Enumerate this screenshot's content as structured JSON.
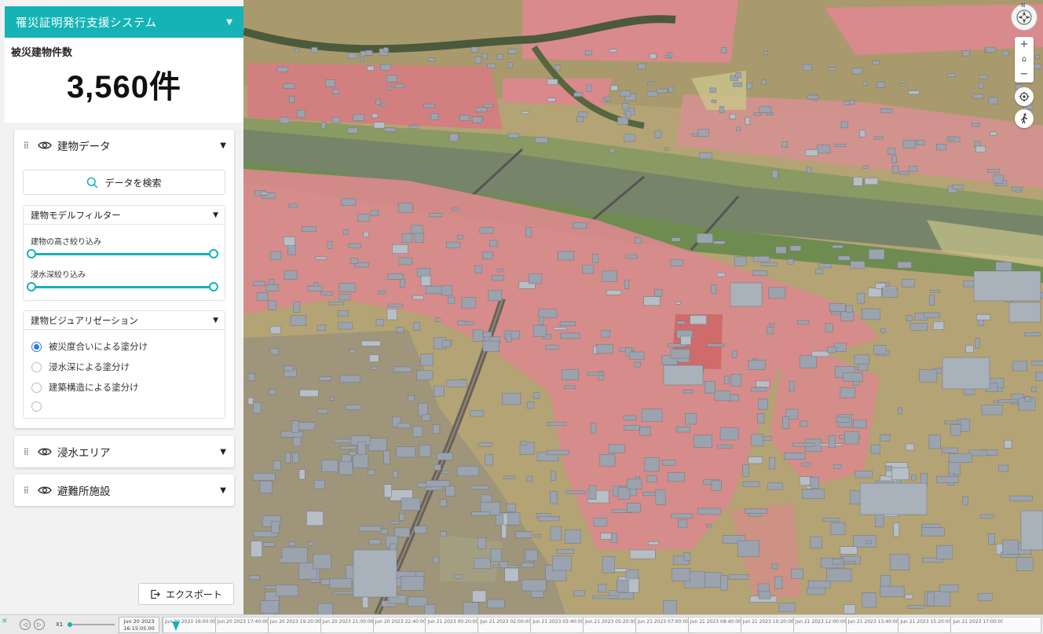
{
  "app": {
    "title": "罹災証明発行支援システム"
  },
  "summary": {
    "label": "被災建物件数",
    "value": "3,560件"
  },
  "layers": {
    "buildings": {
      "name": "建物データ",
      "search_label": "データを検索",
      "filter": {
        "title": "建物モデルフィルター",
        "height_label": "建物の高さ絞り込み",
        "depth_label": "浸水深絞り込み"
      },
      "visualization": {
        "title": "建物ビジュアリゼーション",
        "options": [
          {
            "label": "被災度合いによる塗分け",
            "selected": true
          },
          {
            "label": "浸水深による塗分け",
            "selected": false
          },
          {
            "label": "建築構造による塗分け",
            "selected": false
          },
          {
            "label": "",
            "selected": false
          }
        ]
      }
    },
    "flood_area": {
      "name": "浸水エリア"
    },
    "shelters": {
      "name": "避難所施設"
    }
  },
  "export": {
    "label": "エクスポート"
  },
  "controls": {
    "compass_north": "N",
    "zoom_in": "+",
    "home": "⌂",
    "zoom_out": "−"
  },
  "timeline": {
    "speed": "X1",
    "current_date": "Jun 20 2023",
    "current_time": "16:15:05.00",
    "ticks": [
      "Jun 20 2023 16:00:00.00",
      "Jun 20 2023 17:40:00.00",
      "Jun 20 2023 19:20:00.00",
      "Jun 20 2023 21:00:00.00",
      "Jun 20 2023 22:40:00.00",
      "Jun 21 2023 00:20:00.00",
      "Jun 21 2023 02:00:00.00",
      "Jun 21 2023 03:40:00.00",
      "Jun 21 2023 05:20:00.00",
      "Jun 21 2023 07:00:00.00",
      "Jun 21 2023 08:40:00.00",
      "Jun 21 2023 10:20:00.00",
      "Jun 21 2023 12:00:00.00",
      "Jun 21 2023 13:40:00.00",
      "Jun 21 2023 15:20:00.00",
      "Jun 21 2023 17:00:00.00"
    ]
  },
  "colors": {
    "accent": "#15b3b5",
    "flood": "#d98a8c",
    "ground": "#b9a576",
    "river": "#7d8b6e",
    "building": "#9aa3ad"
  }
}
